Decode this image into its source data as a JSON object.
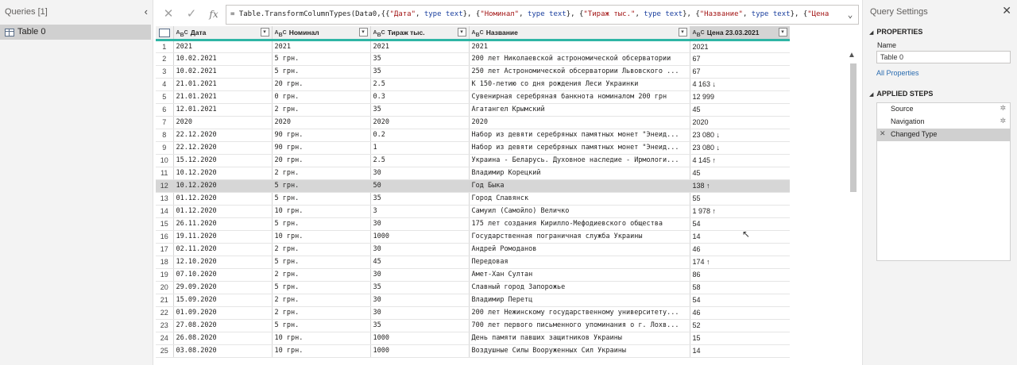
{
  "queries": {
    "title": "Queries [1]",
    "items": [
      {
        "label": "Table 0"
      }
    ]
  },
  "formula": {
    "text": "= Table.TransformColumnTypes(Data0,{{\"Дата\", type text}, {\"Номинал\", type text}, {\"Тираж тыс.\", type text}, {\"Название\", type text}, {\"Цена"
  },
  "table": {
    "columns": [
      "Дата",
      "Номинал",
      "Тираж тыс.",
      "Название",
      "Цена 23.03.2021"
    ],
    "rows": [
      [
        "1",
        "2021",
        "2021",
        "2021",
        "2021",
        "2021"
      ],
      [
        "2",
        "10.02.2021",
        "5 грн.",
        "35",
        "200 лет Николаевской астрономической обсерватории",
        "67"
      ],
      [
        "3",
        "10.02.2021",
        "5 грн.",
        "35",
        "250 лет Астрономической обсерватории Львовского ...",
        "67"
      ],
      [
        "4",
        "21.01.2021",
        "20 грн.",
        "2.5",
        "К 150-летию со дня рождения Леси Украинки",
        "4 163 ↓"
      ],
      [
        "5",
        "21.01.2021",
        "0 грн.",
        "0.3",
        "Сувенирная серебряная банкнота номиналом 200 грн",
        "12 999"
      ],
      [
        "6",
        "12.01.2021",
        "2 грн.",
        "35",
        "Агатангел Крымский",
        "45"
      ],
      [
        "7",
        "2020",
        "2020",
        "2020",
        "2020",
        "2020"
      ],
      [
        "8",
        "22.12.2020",
        "90 грн.",
        "0.2",
        "Набор из девяти серебряных памятных монет \"Энеид...",
        "23 080 ↓"
      ],
      [
        "9",
        "22.12.2020",
        "90 грн.",
        "1",
        "Набор из девяти серебряных памятных монет \"Энеид...",
        "23 080 ↓"
      ],
      [
        "10",
        "15.12.2020",
        "20 грн.",
        "2.5",
        "Украина - Беларусь. Духовное наследие - Ирмологи...",
        "4 145 ↑"
      ],
      [
        "11",
        "10.12.2020",
        "2 грн.",
        "30",
        "Владимир Корецкий",
        "45"
      ],
      [
        "12",
        "10.12.2020",
        "5 грн.",
        "50",
        "Год Быка",
        "138 ↑"
      ],
      [
        "13",
        "01.12.2020",
        "5 грн.",
        "35",
        "Город Славянск",
        "55"
      ],
      [
        "14",
        "01.12.2020",
        "10 грн.",
        "3",
        "Самуил (Самойло) Величко",
        "1 978 ↑"
      ],
      [
        "15",
        "26.11.2020",
        "5 грн.",
        "30",
        "175 лет создания Кирилло-Мефодиевского общества",
        "54"
      ],
      [
        "16",
        "19.11.2020",
        "10 грн.",
        "1000",
        "Государственная пограничная служба Украины",
        "14"
      ],
      [
        "17",
        "02.11.2020",
        "2 грн.",
        "30",
        "Андрей Ромоданов",
        "46"
      ],
      [
        "18",
        "12.10.2020",
        "5 грн.",
        "45",
        "Передовая",
        "174 ↑"
      ],
      [
        "19",
        "07.10.2020",
        "2 грн.",
        "30",
        "Амет-Хан Султан",
        "86"
      ],
      [
        "20",
        "29.09.2020",
        "5 грн.",
        "35",
        "Славный город Запорожье",
        "58"
      ],
      [
        "21",
        "15.09.2020",
        "2 грн.",
        "30",
        "Владимир Перетц",
        "54"
      ],
      [
        "22",
        "01.09.2020",
        "2 грн.",
        "30",
        "200 лет Нежинскому государственному университету...",
        "46"
      ],
      [
        "23",
        "27.08.2020",
        "5 грн.",
        "35",
        "700 лет первого письменного упоминания о г. Лохв...",
        "52"
      ],
      [
        "24",
        "26.08.2020",
        "10 грн.",
        "1000",
        "День памяти павших защитников Украины",
        "15"
      ],
      [
        "25",
        "03.08.2020",
        "10 грн.",
        "1000",
        "Воздушные Силы Вооруженных Сил Украины",
        "14"
      ]
    ],
    "highlight_row": 12
  },
  "settings": {
    "title": "Query Settings",
    "properties_header": "PROPERTIES",
    "name_label": "Name",
    "name_value": "Table 0",
    "all_properties": "All Properties",
    "steps_header": "APPLIED STEPS",
    "steps": [
      {
        "label": "Source",
        "has_gear": true
      },
      {
        "label": "Navigation",
        "has_gear": true
      },
      {
        "label": "Changed Type",
        "has_gear": false,
        "active": true
      }
    ]
  },
  "colors": {
    "header_accent": "#2fb5a5",
    "link": "#2b6cb0"
  }
}
